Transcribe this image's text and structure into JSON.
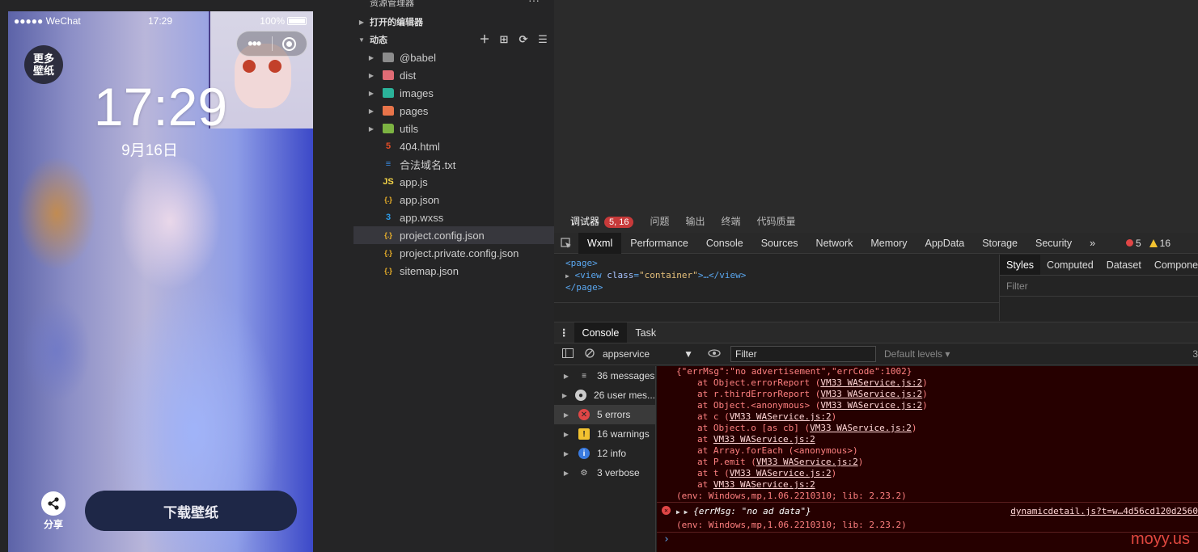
{
  "simulator": {
    "status": {
      "carrier": "●●●●● WeChat",
      "time": "17:29",
      "battery": "100%"
    },
    "more_wallpaper_label": "更多壁纸",
    "big_time": "17:29",
    "big_date": "9月16日",
    "share_label": "分享",
    "download_button": "下载壁纸"
  },
  "explorer": {
    "title": "资源管理器",
    "open_editors": "打开的编辑器",
    "project_section": "动态",
    "items": [
      {
        "name": "@babel",
        "type": "folder",
        "color": "#8c8c8c"
      },
      {
        "name": "dist",
        "type": "folder",
        "color": "#e06c75"
      },
      {
        "name": "images",
        "type": "folder",
        "color": "#2bb39a"
      },
      {
        "name": "pages",
        "type": "folder",
        "color": "#e8744a"
      },
      {
        "name": "utils",
        "type": "folder",
        "color": "#7cb342"
      },
      {
        "name": "404.html",
        "type": "file",
        "icon": "5",
        "color": "#e44d26"
      },
      {
        "name": "合法域名.txt",
        "type": "file",
        "icon": "≡",
        "color": "#3a8ee6"
      },
      {
        "name": "app.js",
        "type": "file",
        "icon": "JS",
        "color": "#f5d547"
      },
      {
        "name": "app.json",
        "type": "file",
        "icon": "{.}",
        "color": "#f0b429"
      },
      {
        "name": "app.wxss",
        "type": "file",
        "icon": "3",
        "color": "#2d9be8"
      },
      {
        "name": "project.config.json",
        "type": "file",
        "icon": "{.}",
        "color": "#f0b429"
      },
      {
        "name": "project.private.config.json",
        "type": "file",
        "icon": "{.}",
        "color": "#f0b429"
      },
      {
        "name": "sitemap.json",
        "type": "file",
        "icon": "{.}",
        "color": "#f0b429"
      }
    ],
    "selected_item": "project.config.json"
  },
  "devtools": {
    "top_tabs": {
      "debugger": "调试器",
      "badge": "5, 16",
      "issues": "问题",
      "output": "输出",
      "terminal": "终端",
      "code_quality": "代码质量"
    },
    "panel_tabs": [
      "Wxml",
      "Performance",
      "Console",
      "Sources",
      "Network",
      "Memory",
      "AppData",
      "Storage",
      "Security"
    ],
    "overflow": "»",
    "error_count": "5",
    "warning_count": "16",
    "wxml": {
      "page_open": "<page>",
      "view_line_tag": "<view",
      "attr_name": "class",
      "attr_value": "\"container\"",
      "view_tail": ">…</view>",
      "page_close": "</page>"
    },
    "styles": {
      "tabs": [
        "Styles",
        "Computed",
        "Dataset",
        "Compone"
      ],
      "filter": "Filter"
    },
    "console_tabs": [
      "Console",
      "Task"
    ],
    "toolbar": {
      "context": "appservice",
      "filter_placeholder": "Filter",
      "levels": "Default levels ▾",
      "count": "3"
    },
    "sidebar": [
      {
        "label": "36 messages",
        "icon": "list"
      },
      {
        "label": "26 user mes...",
        "icon": "user"
      },
      {
        "label": "5 errors",
        "icon": "error"
      },
      {
        "label": "16 warnings",
        "icon": "warning"
      },
      {
        "label": "12 info",
        "icon": "info"
      },
      {
        "label": "3 verbose",
        "icon": "verbose"
      }
    ],
    "log1": {
      "head": "{\"errMsg\":\"no advertisement\",\"errCode\":1002}",
      "stack": [
        {
          "pre": "at Object.errorReport (",
          "link": "VM33 WAService.js:2",
          "post": ")"
        },
        {
          "pre": "at r.thirdErrorReport (",
          "link": "VM33 WAService.js:2",
          "post": ")"
        },
        {
          "pre": "at Object.<anonymous> (",
          "link": "VM33 WAService.js:2",
          "post": ")"
        },
        {
          "pre": "at c (",
          "link": "VM33 WAService.js:2",
          "post": ")"
        },
        {
          "pre": "at Object.o [as cb] (",
          "link": "VM33 WAService.js:2",
          "post": ")"
        },
        {
          "pre": "at ",
          "link": "VM33 WAService.js:2",
          "post": ""
        },
        {
          "pre": "at Array.forEach (<anonymous>)",
          "link": "",
          "post": ""
        },
        {
          "pre": "at P.emit (",
          "link": "VM33 WAService.js:2",
          "post": ")"
        },
        {
          "pre": "at t (",
          "link": "VM33 WAService.js:2",
          "post": ")"
        },
        {
          "pre": "at ",
          "link": "VM33 WAService.js:2",
          "post": ""
        }
      ],
      "env": "(env: Windows,mp,1.06.2210310; lib: 2.23.2)"
    },
    "log2": {
      "obj": "{errMsg: \"no ad data\"}",
      "source": "dynamicdetail.js?t=w…4d56cd120d2560",
      "env": "(env: Windows,mp,1.06.2210310; lib: 2.23.2)"
    },
    "prompt": "›"
  },
  "watermark": "moyy.us"
}
